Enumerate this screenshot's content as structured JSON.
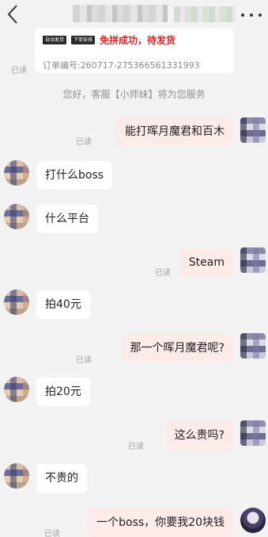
{
  "header": {
    "back_icon": "chevron-left-icon",
    "more_icon": "more-dots-icon"
  },
  "order": {
    "tag1": "自动发货",
    "tag2": "下单安排",
    "status": "免拼成功，待发货",
    "number": "订单编号:260717-275366561331993",
    "read": "已读"
  },
  "system_message": "您好，客服【小师妹】将为您服务",
  "messages": [
    {
      "side": "out",
      "text": "能打晖月魔君和百木",
      "read": "已读"
    },
    {
      "side": "in",
      "text": "打什么boss"
    },
    {
      "side": "in",
      "text": "什么平台"
    },
    {
      "side": "out",
      "text": "Steam",
      "read": "已读"
    },
    {
      "side": "in",
      "text": "拍40元"
    },
    {
      "side": "out",
      "text": "那一个晖月魔君呢?",
      "read": "已读"
    },
    {
      "side": "in",
      "text": "拍20元"
    },
    {
      "side": "out",
      "text": "这么贵吗?",
      "read": "已读"
    },
    {
      "side": "in",
      "text": "不贵的"
    },
    {
      "side": "out",
      "text": "一个boss，你要我20块钱",
      "read": "已读"
    }
  ],
  "colors": {
    "background": "#f2f2f2",
    "incoming_bubble": "#ffffff",
    "outgoing_bubble": "#fdebe9",
    "status_red": "#e02020",
    "muted": "#8f8f8f"
  }
}
